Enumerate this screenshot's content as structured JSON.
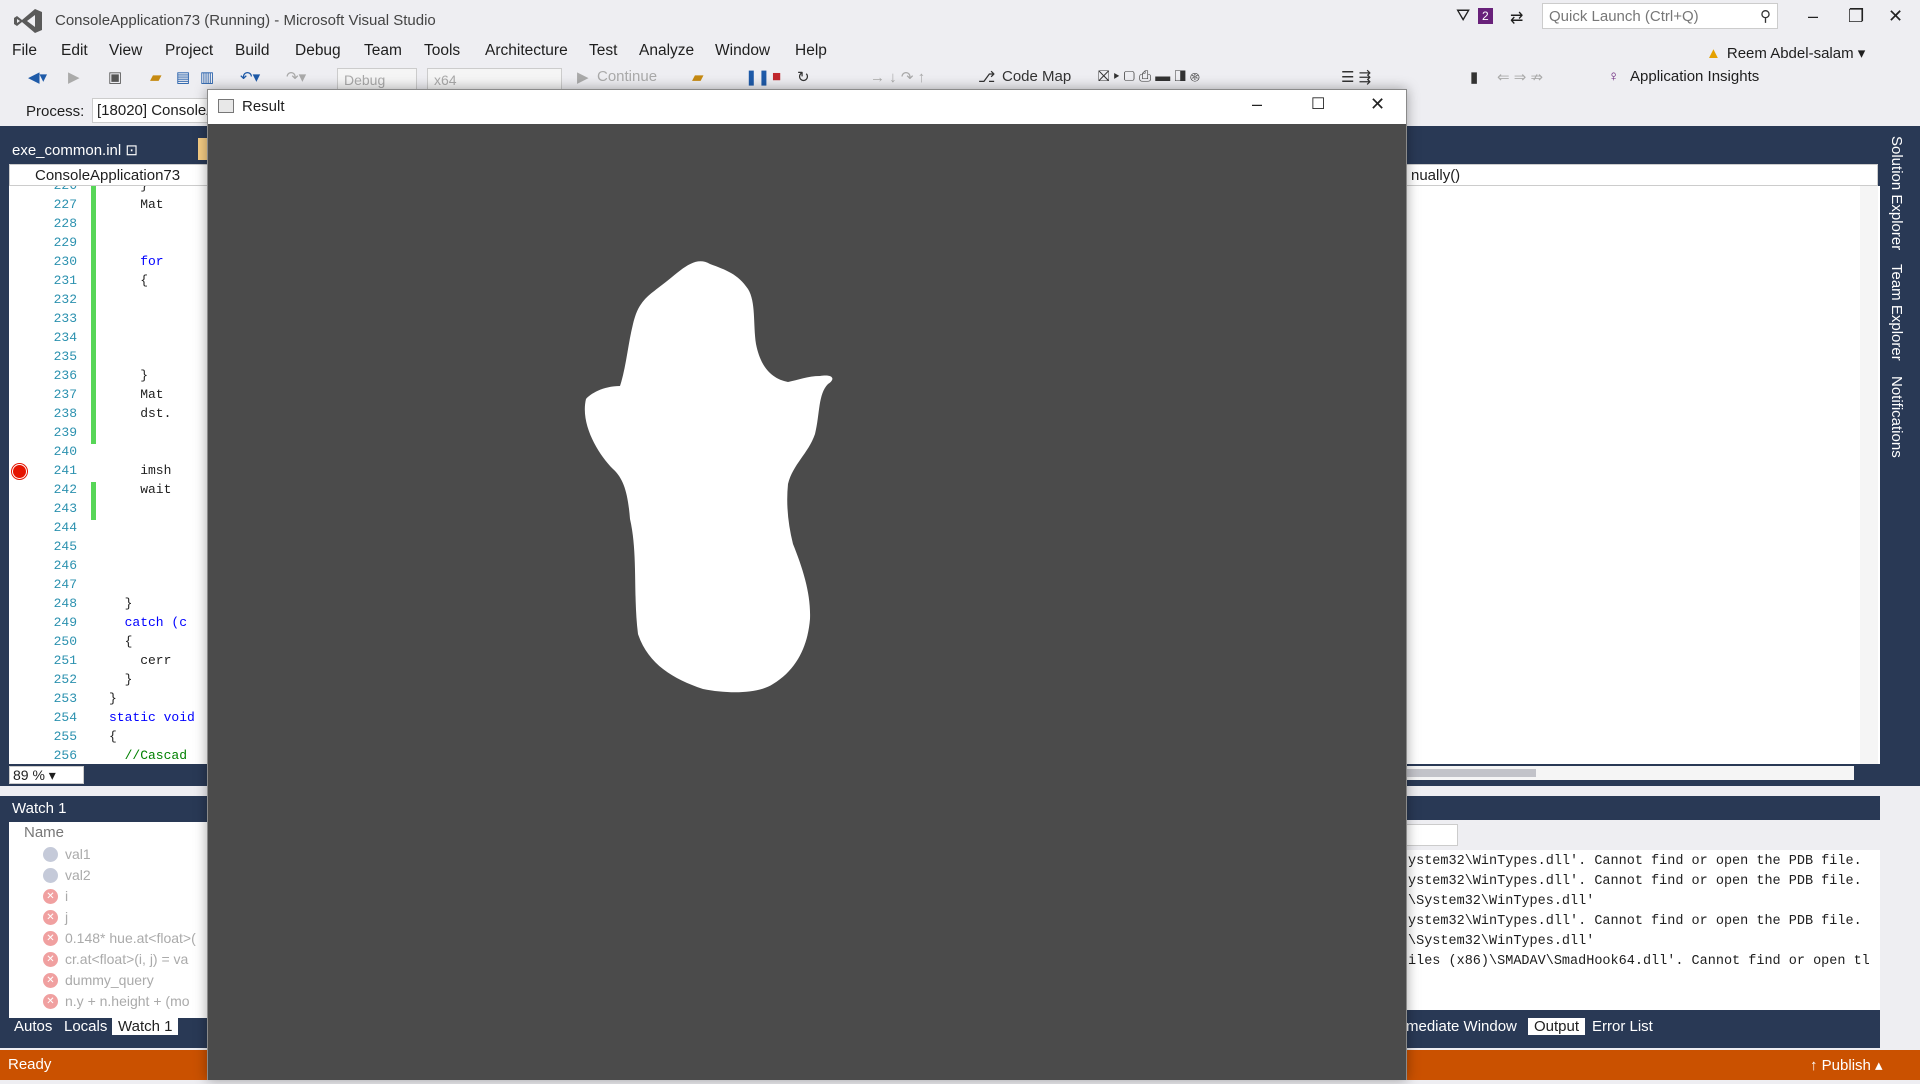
{
  "window": {
    "title": "ConsoleApplication73 (Running) - Microsoft Visual Studio",
    "filter_count": "2",
    "quick_launch_placeholder": "Quick Launch (Ctrl+Q)",
    "minimize_glyph": "‒",
    "restore_glyph": "❐",
    "close_glyph": "✕"
  },
  "menu": [
    "File",
    "Edit",
    "View",
    "Project",
    "Build",
    "Debug",
    "Team",
    "Tools",
    "Architecture",
    "Test",
    "Analyze",
    "Window",
    "Help"
  ],
  "user": {
    "name": "Reem Abdel-salam",
    "warning_glyph": "▲"
  },
  "toolbar": {
    "config": "Debug",
    "platform": "x64",
    "continue_label": "Continue",
    "code_map_label": "Code Map",
    "app_insights_label": "Application Insights"
  },
  "process": {
    "label": "Process:",
    "value": "[18020] ConsoleA"
  },
  "editor": {
    "tab_label": "exe_common.inl",
    "nav_left": "ConsoleApplication73",
    "nav_right": "nually()",
    "zoom": "89 %",
    "lines": [
      {
        "num": "226",
        "code": "    }"
      },
      {
        "num": "227",
        "code": "    Mat"
      },
      {
        "num": "228",
        "code": ""
      },
      {
        "num": "229",
        "code": ""
      },
      {
        "num": "230",
        "code": "    for"
      },
      {
        "num": "231",
        "code": "    {"
      },
      {
        "num": "232",
        "code": ""
      },
      {
        "num": "233",
        "code": ""
      },
      {
        "num": "234",
        "code": ""
      },
      {
        "num": "235",
        "code": ""
      },
      {
        "num": "236",
        "code": "    }"
      },
      {
        "num": "237",
        "code": "    Mat"
      },
      {
        "num": "238",
        "code": "    dst."
      },
      {
        "num": "239",
        "code": ""
      },
      {
        "num": "240",
        "code": ""
      },
      {
        "num": "241",
        "code": "    imsh"
      },
      {
        "num": "242",
        "code": "    wait"
      },
      {
        "num": "243",
        "code": ""
      },
      {
        "num": "244",
        "code": ""
      },
      {
        "num": "245",
        "code": ""
      },
      {
        "num": "246",
        "code": ""
      },
      {
        "num": "247",
        "code": ""
      },
      {
        "num": "248",
        "code": "  }"
      },
      {
        "num": "249",
        "code": "  catch (c"
      },
      {
        "num": "250",
        "code": "  {"
      },
      {
        "num": "251",
        "code": "    cerr"
      },
      {
        "num": "252",
        "code": "  }"
      },
      {
        "num": "253",
        "code": "}"
      },
      {
        "num": "254",
        "code": "static void"
      },
      {
        "num": "255",
        "code": "{"
      },
      {
        "num": "256",
        "code": "  //Cascad"
      }
    ]
  },
  "side_tabs": [
    "Solution Explorer",
    "Team Explorer",
    "Notifications"
  ],
  "watch": {
    "title": "Watch 1",
    "column_name": "Name",
    "rows": [
      {
        "name": "val1",
        "ok": true
      },
      {
        "name": "val2",
        "ok": true
      },
      {
        "name": "i",
        "ok": false
      },
      {
        "name": "j",
        "ok": false
      },
      {
        "name": "0.148* hue.at<float>(",
        "ok": false
      },
      {
        "name": "cr.at<float>(i, j) = va",
        "ok": false
      },
      {
        "name": "dummy_query",
        "ok": false
      },
      {
        "name": "n.y + n.height + (mo",
        "ok": false
      }
    ],
    "tabs": [
      "Autos",
      "Locals",
      "Watch 1"
    ]
  },
  "output": {
    "lines": [
      "ystem32\\WinTypes.dll'. Cannot find or open the PDB file.",
      "ystem32\\WinTypes.dll'. Cannot find or open the PDB file.",
      "\\System32\\WinTypes.dll'",
      "ystem32\\WinTypes.dll'. Cannot find or open the PDB file.",
      "\\System32\\WinTypes.dll'",
      "iles (x86)\\SMADAV\\SmadHook64.dll'. Cannot find or open tl"
    ],
    "tabs": [
      "mediate Window",
      "Output",
      "Error List"
    ]
  },
  "status": {
    "ready": "Ready",
    "publish": "Publish"
  },
  "result_window": {
    "title": "Result"
  }
}
